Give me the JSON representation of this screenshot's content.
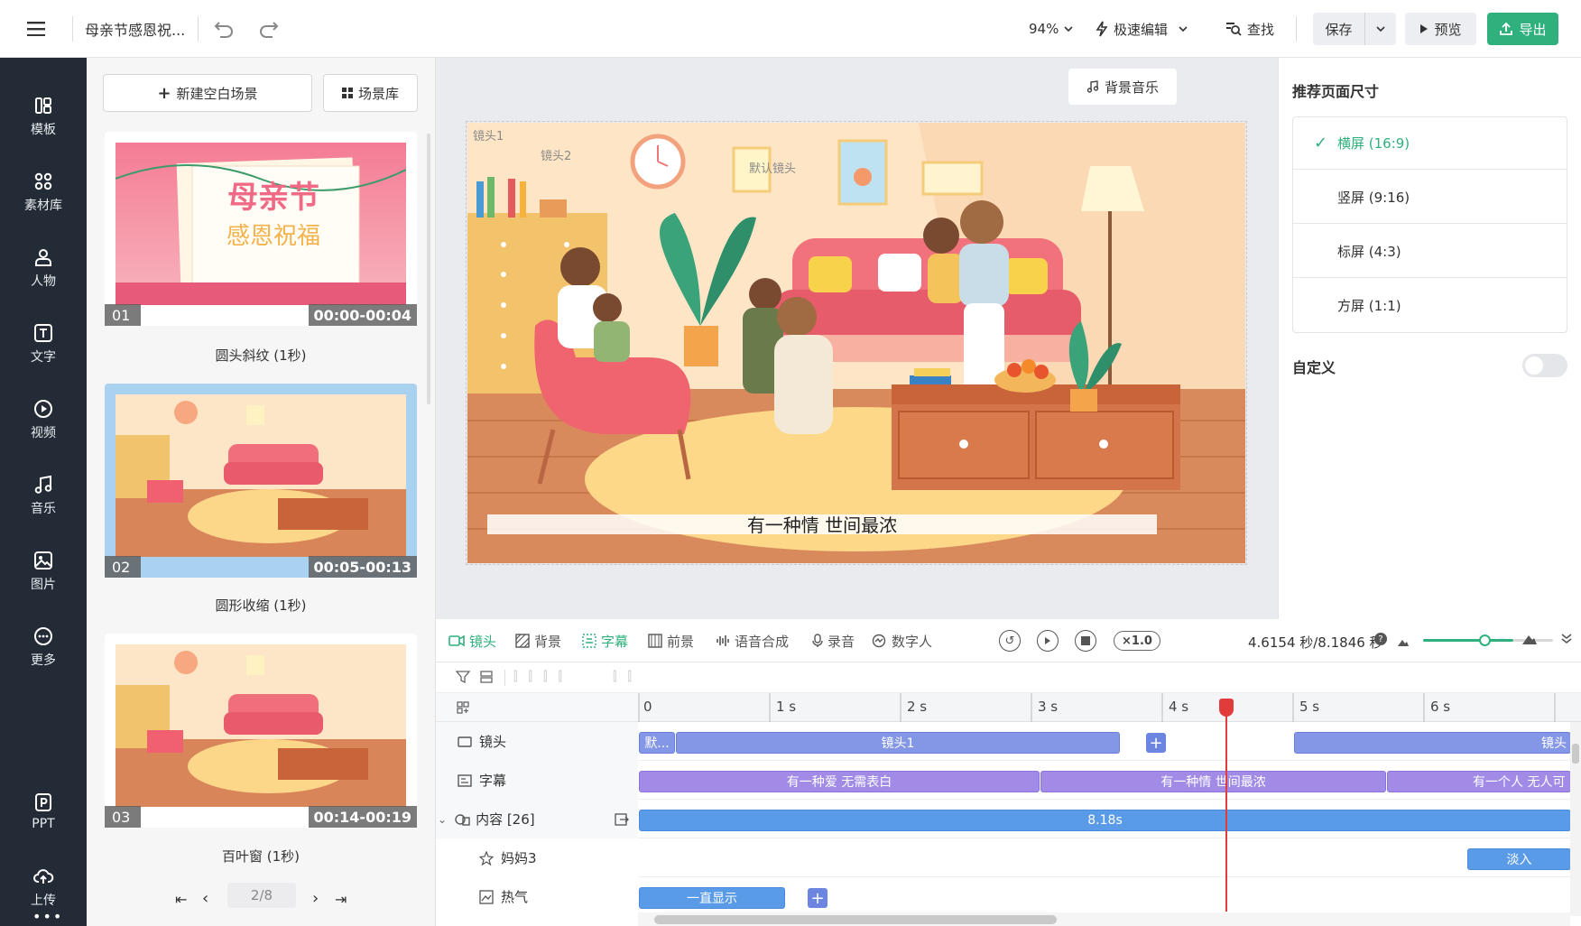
{
  "topbar": {
    "doc_title": "母亲节感恩祝...",
    "zoom": "94%",
    "fast_edit": "极速编辑",
    "find": "查找",
    "save": "保存",
    "preview": "预览",
    "export": "导出"
  },
  "sidebar": {
    "items": [
      {
        "label": "模板",
        "icon": "template-icon"
      },
      {
        "label": "素材库",
        "icon": "assets-icon"
      },
      {
        "label": "人物",
        "icon": "person-icon"
      },
      {
        "label": "文字",
        "icon": "text-icon"
      },
      {
        "label": "视频",
        "icon": "video-icon"
      },
      {
        "label": "音乐",
        "icon": "music-icon"
      },
      {
        "label": "图片",
        "icon": "image-icon"
      },
      {
        "label": "更多",
        "icon": "more-icon"
      },
      {
        "label": "PPT",
        "icon": "ppt-icon"
      },
      {
        "label": "上传",
        "icon": "upload-icon"
      }
    ]
  },
  "scenes": {
    "new_blank": "新建空白场景",
    "library": "场景库",
    "items": [
      {
        "num": "01",
        "time": "00:00-00:04",
        "caption": "圆头斜纹 (1秒)",
        "title1": "母亲节",
        "title2": "感恩祝福"
      },
      {
        "num": "02",
        "time": "00:05-00:13",
        "caption": "圆形收缩 (1秒)"
      },
      {
        "num": "03",
        "time": "00:14-00:19",
        "caption": "百叶窗 (1秒)"
      }
    ],
    "pagination": "2/8"
  },
  "stage": {
    "bgm_button": "背景音乐",
    "cam1": "镜头1",
    "cam2": "镜头2",
    "default_cam": "默认镜头",
    "subtitle": "有一种情 世间最浓"
  },
  "right": {
    "title": "推荐页面尺寸",
    "options": [
      "横屏 (16:9)",
      "竖屏 (9:16)",
      "标屏 (4:3)",
      "方屏 (1:1)"
    ],
    "custom_label": "自定义"
  },
  "timeline": {
    "tabs": [
      "镜头",
      "背景",
      "字幕",
      "前景",
      "语音合成",
      "录音",
      "数字人"
    ],
    "speed": "×1.0",
    "time_readout": "4.6154 秒/8.1846 秒",
    "ruler": [
      "0",
      "1 s",
      "2 s",
      "3 s",
      "4 s",
      "5 s",
      "6 s"
    ],
    "tracks": {
      "camera": "镜头",
      "subtitle": "字幕",
      "content": "内容 [26]",
      "mom3": "妈妈3",
      "steam": "热气"
    },
    "clips": {
      "cam_default": "默...",
      "cam1": "镜头1",
      "cam_next": "镜头",
      "sub1": "有一种爱 无需表白",
      "sub2": "有一种情 世间最浓",
      "sub3": "有一个人 无人可",
      "content": "8.18s",
      "fade_in": "淡入",
      "always": "一直显示"
    }
  },
  "colors": {
    "accent": "#2fb07c",
    "sidebar_bg": "#232c36",
    "playhead": "#e23b3b"
  }
}
